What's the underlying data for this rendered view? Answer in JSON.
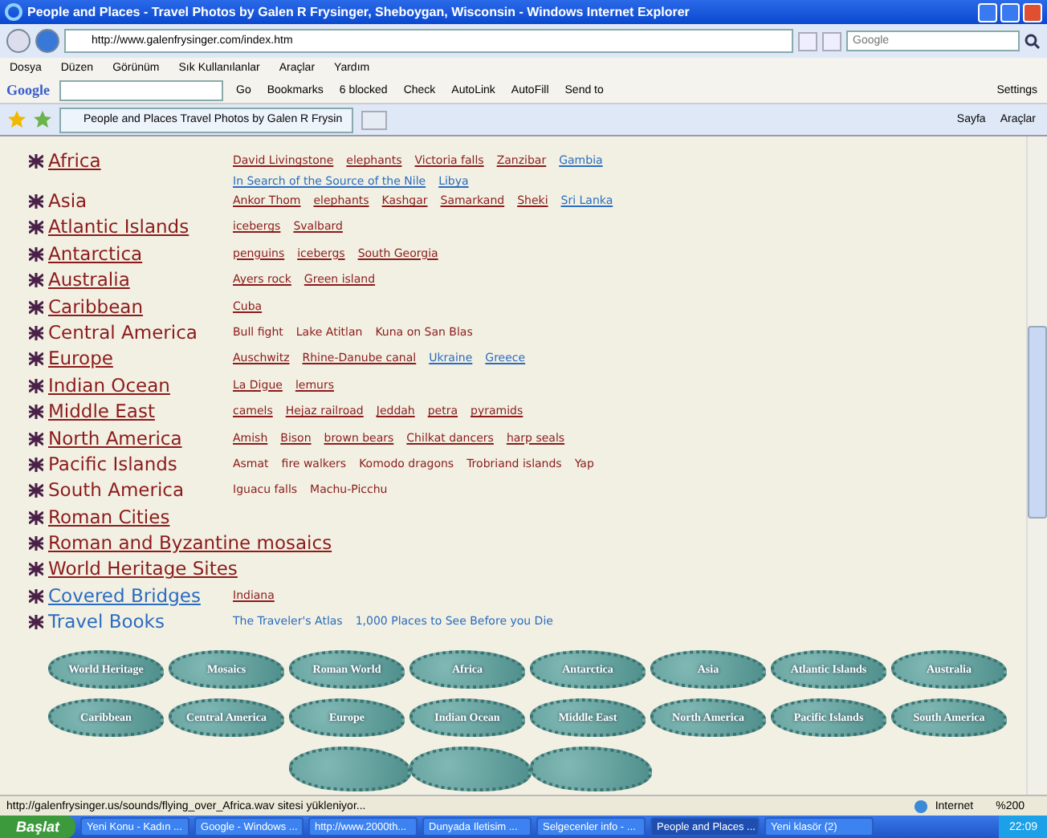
{
  "window": {
    "title": "People and Places  -  Travel Photos by Galen R Frysinger, Sheboygan, Wisconsin - Windows Internet Explorer"
  },
  "address_bar": {
    "url": "http://www.galenfrysinger.com/index.htm",
    "search_placeholder": "Google"
  },
  "menu": [
    "Dosya",
    "Düzen",
    "Görünüm",
    "Sık Kullanılanlar",
    "Araçlar",
    "Yardım"
  ],
  "google_toolbar": {
    "logo": "Google",
    "go": "Go",
    "items": [
      "Bookmarks",
      "6 blocked",
      "Check",
      "AutoLink",
      "AutoFill",
      "Send to"
    ],
    "settings": "Settings"
  },
  "tab": {
    "label": "People and Places    Travel Photos by Galen R Frysin"
  },
  "command_bar": [
    "Sayfa",
    "Araçlar"
  ],
  "regions": [
    {
      "name": "Africa",
      "color": "#8b1a1a",
      "underlined": true,
      "links": [
        {
          "text": "David Livingstone",
          "color": "#8b1a1a",
          "underlined": true
        },
        {
          "text": "elephants",
          "color": "#8b1a1a",
          "underlined": true
        },
        {
          "text": "Victoria falls",
          "color": "#8b1a1a",
          "underlined": true
        },
        {
          "text": "Zanzibar",
          "color": "#8b1a1a",
          "underlined": true
        },
        {
          "text": "Gambia",
          "color": "#2a6cc0",
          "underlined": true
        },
        {
          "text": "In Search of the Source of the Nile",
          "color": "#2a6cc0",
          "underlined": true
        },
        {
          "text": "Libya",
          "color": "#2a6cc0",
          "underlined": true
        }
      ]
    },
    {
      "name": "Asia",
      "color": "#8b1a1a",
      "underlined": false,
      "links": [
        {
          "text": "Ankor Thom",
          "color": "#8b1a1a",
          "underlined": true
        },
        {
          "text": "elephants",
          "color": "#8b1a1a",
          "underlined": true
        },
        {
          "text": "Kashgar",
          "color": "#8b1a1a",
          "underlined": true
        },
        {
          "text": "Samarkand",
          "color": "#8b1a1a",
          "underlined": true
        },
        {
          "text": "Sheki",
          "color": "#8b1a1a",
          "underlined": true
        },
        {
          "text": "Sri Lanka",
          "color": "#2a6cc0",
          "underlined": true
        }
      ]
    },
    {
      "name": "Atlantic Islands",
      "color": "#8b1a1a",
      "underlined": true,
      "links": [
        {
          "text": "icebergs",
          "color": "#8b1a1a",
          "underlined": true
        },
        {
          "text": "Svalbard",
          "color": "#8b1a1a",
          "underlined": true
        }
      ]
    },
    {
      "name": "Antarctica",
      "color": "#8b1a1a",
      "underlined": true,
      "links": [
        {
          "text": "penguins",
          "color": "#8b1a1a",
          "underlined": true
        },
        {
          "text": "icebergs",
          "color": "#8b1a1a",
          "underlined": true
        },
        {
          "text": "South Georgia",
          "color": "#8b1a1a",
          "underlined": true
        }
      ]
    },
    {
      "name": "Australia",
      "color": "#8b1a1a",
      "underlined": true,
      "links": [
        {
          "text": "Ayers rock",
          "color": "#8b1a1a",
          "underlined": true
        },
        {
          "text": "Green island",
          "color": "#8b1a1a",
          "underlined": true
        }
      ]
    },
    {
      "name": "Caribbean",
      "color": "#8b1a1a",
      "underlined": true,
      "links": [
        {
          "text": "Cuba",
          "color": "#8b1a1a",
          "underlined": true
        }
      ]
    },
    {
      "name": "Central America",
      "color": "#8b1a1a",
      "underlined": false,
      "links": [
        {
          "text": "Bull fight",
          "color": "#8b1a1a",
          "underlined": false
        },
        {
          "text": "Lake Atitlan",
          "color": "#8b1a1a",
          "underlined": false
        },
        {
          "text": "Kuna on San Blas",
          "color": "#8b1a1a",
          "underlined": false
        }
      ]
    },
    {
      "name": "Europe",
      "color": "#8b1a1a",
      "underlined": true,
      "links": [
        {
          "text": "Auschwitz",
          "color": "#8b1a1a",
          "underlined": true
        },
        {
          "text": "Rhine-Danube canal",
          "color": "#8b1a1a",
          "underlined": true
        },
        {
          "text": "Ukraine",
          "color": "#2a6cc0",
          "underlined": true
        },
        {
          "text": "Greece",
          "color": "#2a6cc0",
          "underlined": true
        }
      ]
    },
    {
      "name": "Indian Ocean",
      "color": "#8b1a1a",
      "underlined": true,
      "links": [
        {
          "text": "La Digue",
          "color": "#8b1a1a",
          "underlined": true
        },
        {
          "text": "lemurs",
          "color": "#8b1a1a",
          "underlined": true
        }
      ]
    },
    {
      "name": "Middle East",
      "color": "#8b1a1a",
      "underlined": true,
      "links": [
        {
          "text": "camels",
          "color": "#8b1a1a",
          "underlined": true
        },
        {
          "text": "Hejaz railroad",
          "color": "#8b1a1a",
          "underlined": true
        },
        {
          "text": "Jeddah",
          "color": "#8b1a1a",
          "underlined": true
        },
        {
          "text": "petra",
          "color": "#8b1a1a",
          "underlined": true
        },
        {
          "text": "pyramids",
          "color": "#8b1a1a",
          "underlined": true
        }
      ]
    },
    {
      "name": "North America",
      "color": "#8b1a1a",
      "underlined": true,
      "links": [
        {
          "text": "Amish",
          "color": "#8b1a1a",
          "underlined": true
        },
        {
          "text": "Bison",
          "color": "#8b1a1a",
          "underlined": true
        },
        {
          "text": "brown bears",
          "color": "#8b1a1a",
          "underlined": true
        },
        {
          "text": "Chilkat dancers",
          "color": "#8b1a1a",
          "underlined": true
        },
        {
          "text": "harp seals",
          "color": "#8b1a1a",
          "underlined": true
        }
      ]
    },
    {
      "name": "Pacific Islands",
      "color": "#8b1a1a",
      "underlined": false,
      "links": [
        {
          "text": "Asmat",
          "color": "#8b1a1a",
          "underlined": false
        },
        {
          "text": "fire walkers",
          "color": "#8b1a1a",
          "underlined": false
        },
        {
          "text": "Komodo dragons",
          "color": "#8b1a1a",
          "underlined": false
        },
        {
          "text": "Trobriand islands",
          "color": "#8b1a1a",
          "underlined": false
        },
        {
          "text": "Yap",
          "color": "#8b1a1a",
          "underlined": false
        }
      ]
    },
    {
      "name": "South America",
      "color": "#8b1a1a",
      "underlined": false,
      "links": [
        {
          "text": "Iguacu falls",
          "color": "#8b1a1a",
          "underlined": false
        },
        {
          "text": "Machu-Picchu",
          "color": "#8b1a1a",
          "underlined": false
        }
      ]
    },
    {
      "name": "Roman Cities",
      "color": "#8b1a1a",
      "underlined": true
    },
    {
      "name": "Roman and Byzantine mosaics",
      "color": "#8b1a1a",
      "underlined": true
    },
    {
      "name": "World Heritage Sites",
      "color": "#8b1a1a",
      "underlined": true
    },
    {
      "name": "Covered Bridges",
      "color": "#2a6cc0",
      "underlined": true,
      "links": [
        {
          "text": "Indiana",
          "color": "#8b1a1a",
          "underlined": true
        }
      ]
    },
    {
      "name": "Travel Books",
      "color": "#2a6cc0",
      "underlined": false,
      "links": [
        {
          "text": "The Traveler's Atlas",
          "color": "#2a6cc0",
          "underlined": false
        },
        {
          "text": "1,000 Places to See Before you Die",
          "color": "#2a6cc0",
          "underlined": false
        }
      ]
    }
  ],
  "nav_buttons": [
    [
      "World Heritage",
      "Mosaics",
      "Roman World",
      "Africa",
      "Antarctica",
      "Asia",
      "Atlantic Islands",
      "Australia"
    ],
    [
      "Caribbean",
      "Central America",
      "Europe",
      "Indian Ocean",
      "Middle East",
      "North America",
      "Pacific Islands",
      "South America"
    ]
  ],
  "status_bar": {
    "text": "http://galenfrysinger.us/sounds/flying_over_Africa.wav sitesi yükleniyor...",
    "zone": "Internet",
    "zoom": "%200"
  },
  "taskbar": {
    "start": "Başlat",
    "items": [
      {
        "label": "Yeni Konu - Kadın ...",
        "selected": false
      },
      {
        "label": "Google - Windows ...",
        "selected": false
      },
      {
        "label": "http://www.2000th...",
        "selected": false
      },
      {
        "label": "Dunyada Iletisim ...",
        "selected": false
      },
      {
        "label": "Selgecenler info - ...",
        "selected": false
      },
      {
        "label": "People and Places ...",
        "selected": true
      },
      {
        "label": "Yeni klasör (2)",
        "selected": false
      }
    ],
    "clock": "22:09"
  }
}
